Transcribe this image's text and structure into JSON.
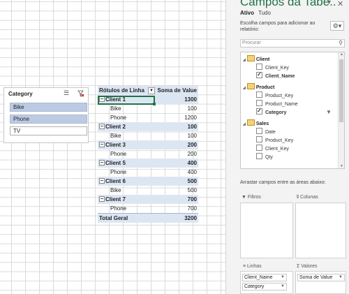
{
  "slicer": {
    "title": "Category",
    "items": [
      {
        "label": "Bike",
        "selected": true
      },
      {
        "label": "Phone",
        "selected": true
      },
      {
        "label": "TV",
        "selected": false
      }
    ]
  },
  "pivot": {
    "header_row_label": "Rótulos de Linha",
    "header_value_label": "Soma de Value",
    "rows": [
      {
        "label": "Client 1",
        "value": "1300",
        "level": 0
      },
      {
        "label": "Bike",
        "value": "100",
        "level": 1
      },
      {
        "label": "Phone",
        "value": "1200",
        "level": 1
      },
      {
        "label": "Client 2",
        "value": "100",
        "level": 0
      },
      {
        "label": "Bike",
        "value": "100",
        "level": 1
      },
      {
        "label": "Client 3",
        "value": "200",
        "level": 0
      },
      {
        "label": "Phone",
        "value": "200",
        "level": 1
      },
      {
        "label": "Client 5",
        "value": "400",
        "level": 0
      },
      {
        "label": "Phone",
        "value": "400",
        "level": 1
      },
      {
        "label": "Client 6",
        "value": "500",
        "level": 0
      },
      {
        "label": "Bike",
        "value": "500",
        "level": 1
      },
      {
        "label": "Client 7",
        "value": "700",
        "level": 0
      },
      {
        "label": "Phone",
        "value": "700",
        "level": 1
      }
    ],
    "total_label": "Total Geral",
    "total_value": "3200"
  },
  "pane": {
    "title": "Campos da Tabe..",
    "tab_active": "Ativo",
    "tab_all": "Tudo",
    "hint": "Escolha campos para adicionar ao relatório:",
    "search_placeholder": "Procurar",
    "tables": [
      {
        "name": "Client",
        "fields": [
          {
            "label": "Client_Key",
            "checked": false
          },
          {
            "label": "Client_Name",
            "checked": true
          }
        ]
      },
      {
        "name": "Product",
        "fields": [
          {
            "label": "Product_Key",
            "checked": false
          },
          {
            "label": "Product_Name",
            "checked": false
          },
          {
            "label": "Category",
            "checked": true
          }
        ]
      },
      {
        "name": "Sales",
        "fields": [
          {
            "label": "Date",
            "checked": false
          },
          {
            "label": "Product_Key",
            "checked": false
          },
          {
            "label": "Client_Key",
            "checked": false
          },
          {
            "label": "Qty",
            "checked": false
          }
        ]
      }
    ],
    "drag_hint": "Arrastar campos entre as áreas abaixo:",
    "areas": {
      "filters": "Filtros",
      "columns": "Colunas",
      "rows": "Linhas",
      "values": "Valores"
    },
    "rows_chips": [
      "Client_Name",
      "Category"
    ],
    "values_chips": [
      "Soma de Value"
    ]
  }
}
